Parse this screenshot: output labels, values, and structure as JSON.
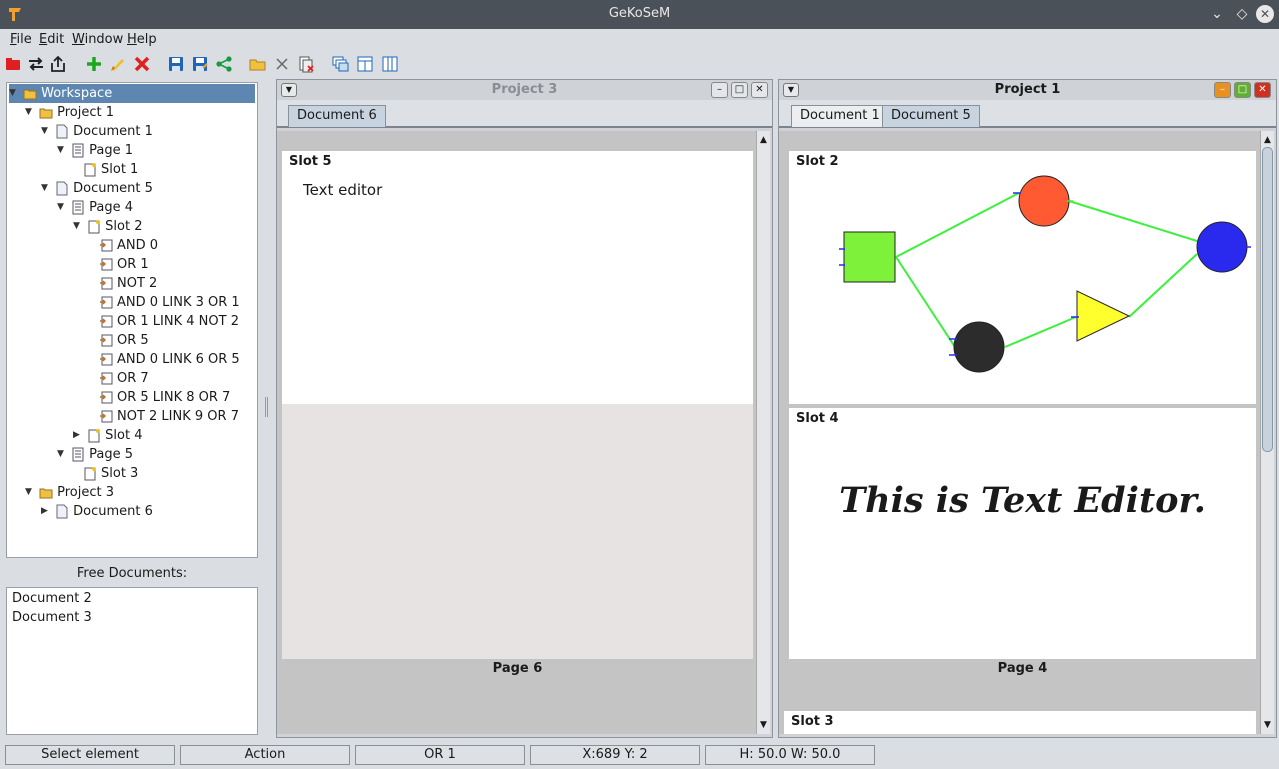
{
  "window": {
    "title": "GeKoSeM"
  },
  "menu": [
    {
      "label": "File",
      "mnemonic": "F",
      "rest": "ile"
    },
    {
      "label": "Edit",
      "mnemonic": "E",
      "rest": "dit"
    },
    {
      "label": "Window",
      "mnemonic": "W",
      "rest": "indow"
    },
    {
      "label": "Help",
      "mnemonic": "H",
      "rest": "elp"
    }
  ],
  "toolbar_icons": [
    "new-project-icon",
    "swap-icon",
    "export-icon",
    "add-icon",
    "edit-icon",
    "delete-icon",
    "save-icon",
    "save-as-icon",
    "share-icon",
    "open-folder-icon",
    "close-document-icon",
    "delete-document-icon",
    "cascade-windows-icon",
    "tile-horizontal-icon",
    "tile-vertical-icon"
  ],
  "tree": {
    "workspace": "Workspace",
    "project1": "Project 1",
    "document1": "Document 1",
    "page1": "Page 1",
    "slot1": "Slot 1",
    "document5": "Document 5",
    "page4": "Page 4",
    "slot2": "Slot 2",
    "elements": [
      "AND 0",
      "OR 1",
      "NOT 2",
      "AND 0 LINK 3 OR 1",
      "OR 1 LINK 4 NOT 2",
      "OR 5",
      "AND 0 LINK 6 OR 5",
      "OR 7",
      "OR 5 LINK 8 OR 7",
      "NOT 2 LINK 9 OR 7"
    ],
    "slot4": "Slot 4",
    "page5": "Page 5",
    "slot3": "Slot 3",
    "project3": "Project 3",
    "document6": "Document 6"
  },
  "free_documents": {
    "label": "Free Documents:",
    "items": [
      "Document 2",
      "Document 3"
    ]
  },
  "frame_project3": {
    "title": "Project 3",
    "tabs": [
      "Document 6"
    ],
    "slot_label": "Slot 5",
    "slot_text": "Text editor",
    "page_label": "Page 6"
  },
  "frame_project1": {
    "title": "Project 1",
    "tabs": [
      "Document 1",
      "Document 5"
    ],
    "slot2_label": "Slot 2",
    "slot4_label": "Slot 4",
    "slot4_text": "This is Text Editor.",
    "page_label": "Page 4",
    "slot3_label": "Slot 3"
  },
  "colors": {
    "green_node": "#7ef23a",
    "red_node": "#ff5a32",
    "blue_node": "#2a2aee",
    "dark_node": "#2c2c2c",
    "yellow_node": "#ffff2e",
    "link": "#3cf03c"
  },
  "status": {
    "mode": "Select element",
    "action": "Action",
    "element": "OR 1",
    "coords": "X:689 Y: 2",
    "size": "H: 50.0 W: 50.0"
  }
}
